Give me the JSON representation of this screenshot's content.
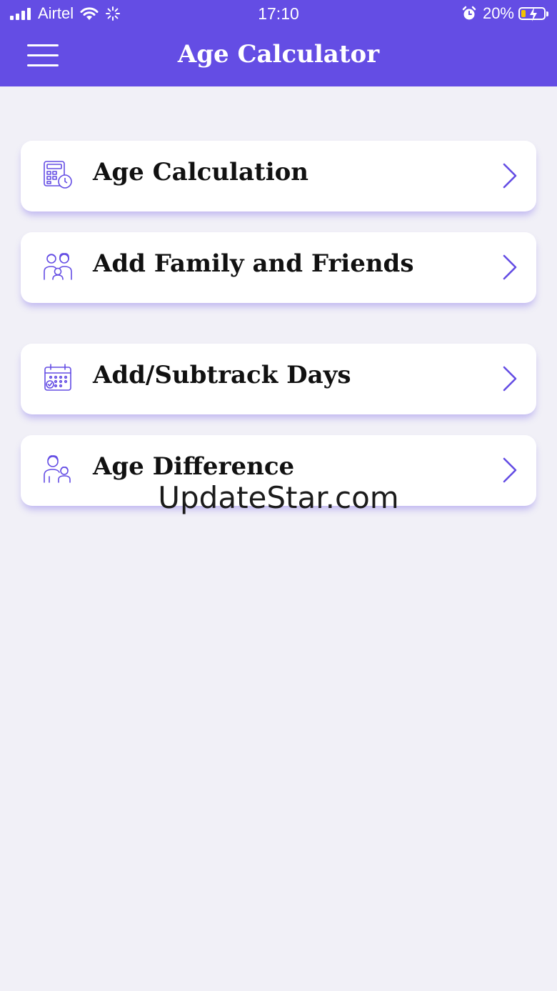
{
  "status_bar": {
    "carrier": "Airtel",
    "time": "17:10",
    "battery_percent": "20%",
    "battery_level": 0.2,
    "icons": [
      "signal-icon",
      "wifi-icon",
      "loading-icon",
      "alarm-icon",
      "battery-icon"
    ]
  },
  "header": {
    "title": "Age Calculator",
    "background": "#644de4"
  },
  "menu": [
    {
      "label": "Age Calculation",
      "icon": "calculator-clock-icon"
    },
    {
      "label": "Add Family and Friends",
      "icon": "family-icon"
    },
    {
      "label": "Add/Subtrack Days",
      "icon": "calendar-check-icon"
    },
    {
      "label": "Age Difference",
      "icon": "parent-child-icon"
    }
  ],
  "watermark": "UpdateStar.com",
  "colors": {
    "accent": "#644de4",
    "background": "#f1f0f7",
    "card": "#ffffff",
    "text": "#111111"
  }
}
